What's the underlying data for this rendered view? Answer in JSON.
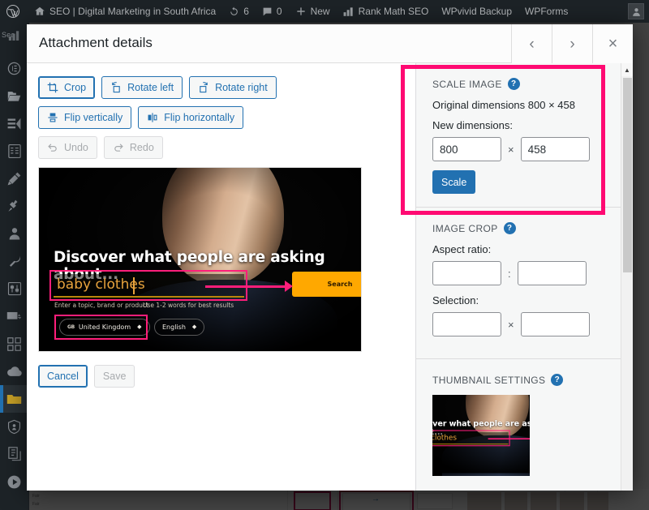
{
  "adminbar": {
    "logo_icon": "wordpress-logo-icon",
    "items": [
      {
        "icon": "home-icon",
        "label": "SEO | Digital Marketing in South Africa"
      },
      {
        "icon": "updates-icon",
        "label": "6"
      },
      {
        "icon": "comment-icon",
        "label": "0"
      },
      {
        "icon": "plus-icon",
        "label": "New"
      },
      {
        "icon": "rank-math-icon",
        "label": "Rank Math SEO"
      },
      {
        "icon": "",
        "label": "WPvivid Backup"
      },
      {
        "icon": "",
        "label": "WPForms"
      }
    ],
    "avatar_icon": "user-avatar-icon"
  },
  "sidebar": {
    "collapsed_label": "Seo",
    "items": [
      {
        "name": "rank-math",
        "icon": "rank-math-icon"
      },
      {
        "name": "dashboard",
        "icon": "dashboard-icon"
      },
      {
        "name": "media",
        "icon": "media-folder-icon",
        "current": true
      },
      {
        "name": "pages",
        "icon": "pages-icon"
      },
      {
        "name": "forms",
        "icon": "forms-icon"
      },
      {
        "name": "appearance",
        "icon": "appearance-brush-icon"
      },
      {
        "name": "plugins",
        "icon": "plugin-icon"
      },
      {
        "name": "users",
        "icon": "users-icon"
      },
      {
        "name": "tools",
        "icon": "tools-wrench-icon"
      },
      {
        "name": "settings",
        "icon": "settings-sliders-icon"
      },
      {
        "name": "mail",
        "icon": "mail-send-icon"
      },
      {
        "name": "addons",
        "icon": "grid-blocks-icon"
      },
      {
        "name": "cloud",
        "icon": "cloud-icon"
      },
      {
        "name": "folders",
        "icon": "folder-icon"
      },
      {
        "name": "security",
        "icon": "shield-icon"
      },
      {
        "name": "docs",
        "icon": "documents-icon"
      },
      {
        "name": "video",
        "icon": "play-circle-icon"
      }
    ]
  },
  "modal": {
    "title": "Attachment details",
    "header_buttons": [
      {
        "name": "previous-attachment",
        "glyph": "‹"
      },
      {
        "name": "next-attachment",
        "glyph": "›"
      },
      {
        "name": "close-modal",
        "glyph": "×"
      }
    ]
  },
  "editor": {
    "tools": [
      {
        "name": "crop",
        "label": "Crop",
        "icon": "crop-icon",
        "state": "active"
      },
      {
        "name": "rotate-left",
        "label": "Rotate left",
        "icon": "rotate-left-icon",
        "state": "enabled"
      },
      {
        "name": "rotate-right",
        "label": "Rotate right",
        "icon": "rotate-right-icon",
        "state": "enabled"
      },
      {
        "name": "flip-vertical",
        "label": "Flip vertically",
        "icon": "flip-vertical-icon",
        "state": "enabled"
      },
      {
        "name": "flip-horizontal",
        "label": "Flip horizontally",
        "icon": "flip-horizontal-icon",
        "state": "enabled"
      },
      {
        "name": "undo",
        "label": "Undo",
        "icon": "undo-icon",
        "state": "disabled"
      },
      {
        "name": "redo",
        "label": "Redo",
        "icon": "redo-icon",
        "state": "disabled"
      }
    ],
    "actions": [
      {
        "name": "cancel",
        "label": "Cancel",
        "state": "enabled"
      },
      {
        "name": "save",
        "label": "Save",
        "state": "disabled"
      }
    ]
  },
  "preview_image": {
    "headline": "Discover what people are asking about...",
    "query_value": "baby clothes",
    "hint_left": "Enter a topic, brand or product",
    "hint_right": "Use 1-2 words for best results",
    "search_button": "Search",
    "country_flag": "GB",
    "country": "United Kingdom",
    "language": "English",
    "accent_orange": "#ffa800",
    "annotation_pink": "#ff1e7a"
  },
  "scale_panel": {
    "title": "SCALE IMAGE",
    "help_glyph": "?",
    "original_dimensions": "Original dimensions 800 × 458",
    "new_dimensions_label": "New dimensions:",
    "width_value": "800",
    "height_value": "458",
    "separator": "×",
    "scale_button": "Scale",
    "highlight_color": "#ff0a72"
  },
  "crop_panel": {
    "title": "IMAGE CROP",
    "help_glyph": "?",
    "aspect_ratio_label": "Aspect ratio:",
    "aspect_w": "",
    "aspect_h": "",
    "aspect_separator": ":",
    "selection_label": "Selection:",
    "selection_w": "",
    "selection_h": "",
    "selection_separator": "×"
  },
  "thumbnail_panel": {
    "title": "THUMBNAIL SETTINGS",
    "help_glyph": "?"
  },
  "scrollbar": {
    "up_glyph": "▲"
  }
}
